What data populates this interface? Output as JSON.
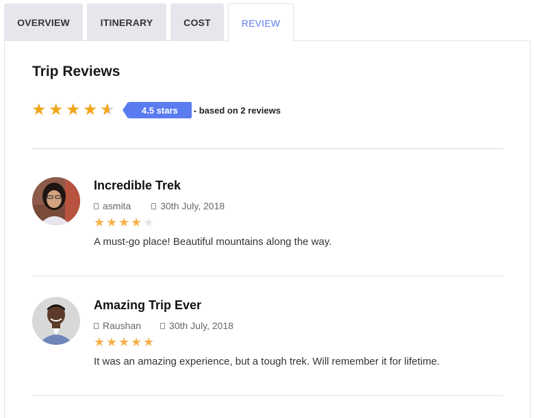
{
  "tabs": [
    {
      "label": "OVERVIEW",
      "active": false
    },
    {
      "label": "ITINERARY",
      "active": false
    },
    {
      "label": "COST",
      "active": false
    },
    {
      "label": "REVIEW",
      "active": true
    }
  ],
  "section_title": "Trip Reviews",
  "summary": {
    "rating": 4.5,
    "rating_label": "4.5 stars",
    "based_on": "- based on 2 reviews",
    "star_color": "#f2a51a",
    "badge_color": "#5b7cf0"
  },
  "reviews": [
    {
      "title": "Incredible Trek",
      "author": "asmita",
      "date": "30th July, 2018",
      "rating": 4,
      "text": "A must-go place! Beautiful mountains along the way.",
      "author_icon": "user-icon",
      "date_icon": "calendar-icon"
    },
    {
      "title": "Amazing Trip Ever",
      "author": "Raushan",
      "date": "30th July, 2018",
      "rating": 5,
      "text": "It was an amazing experience, but a tough trek. Will remember it for lifetime.",
      "author_icon": "user-icon",
      "date_icon": "calendar-icon"
    }
  ]
}
